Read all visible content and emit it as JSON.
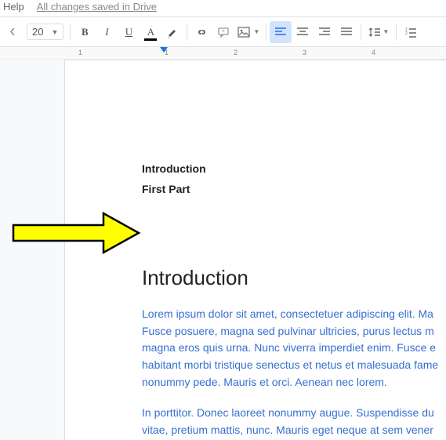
{
  "menubar": {
    "help": "Help",
    "saved_status": "All changes saved in Drive"
  },
  "toolbar": {
    "font_size": "20"
  },
  "ruler": {
    "marks": [
      "1",
      "1",
      "2",
      "3",
      "4"
    ]
  },
  "document": {
    "toc": [
      "Introduction",
      "First Part"
    ],
    "heading": "Introduction",
    "paragraphs": [
      "Lorem ipsum dolor sit amet, consectetuer adipiscing elit. Ma Fusce posuere, magna sed pulvinar ultricies, purus lectus m magna eros quis urna. Nunc viverra imperdiet enim. Fusce e habitant morbi tristique senectus et netus et malesuada fame nonummy pede. Mauris et orci. Aenean nec lorem.",
      "In porttitor. Donec laoreet nonummy augue. Suspendisse du vitae, pretium mattis, nunc. Mauris eget neque at sem vener"
    ]
  }
}
